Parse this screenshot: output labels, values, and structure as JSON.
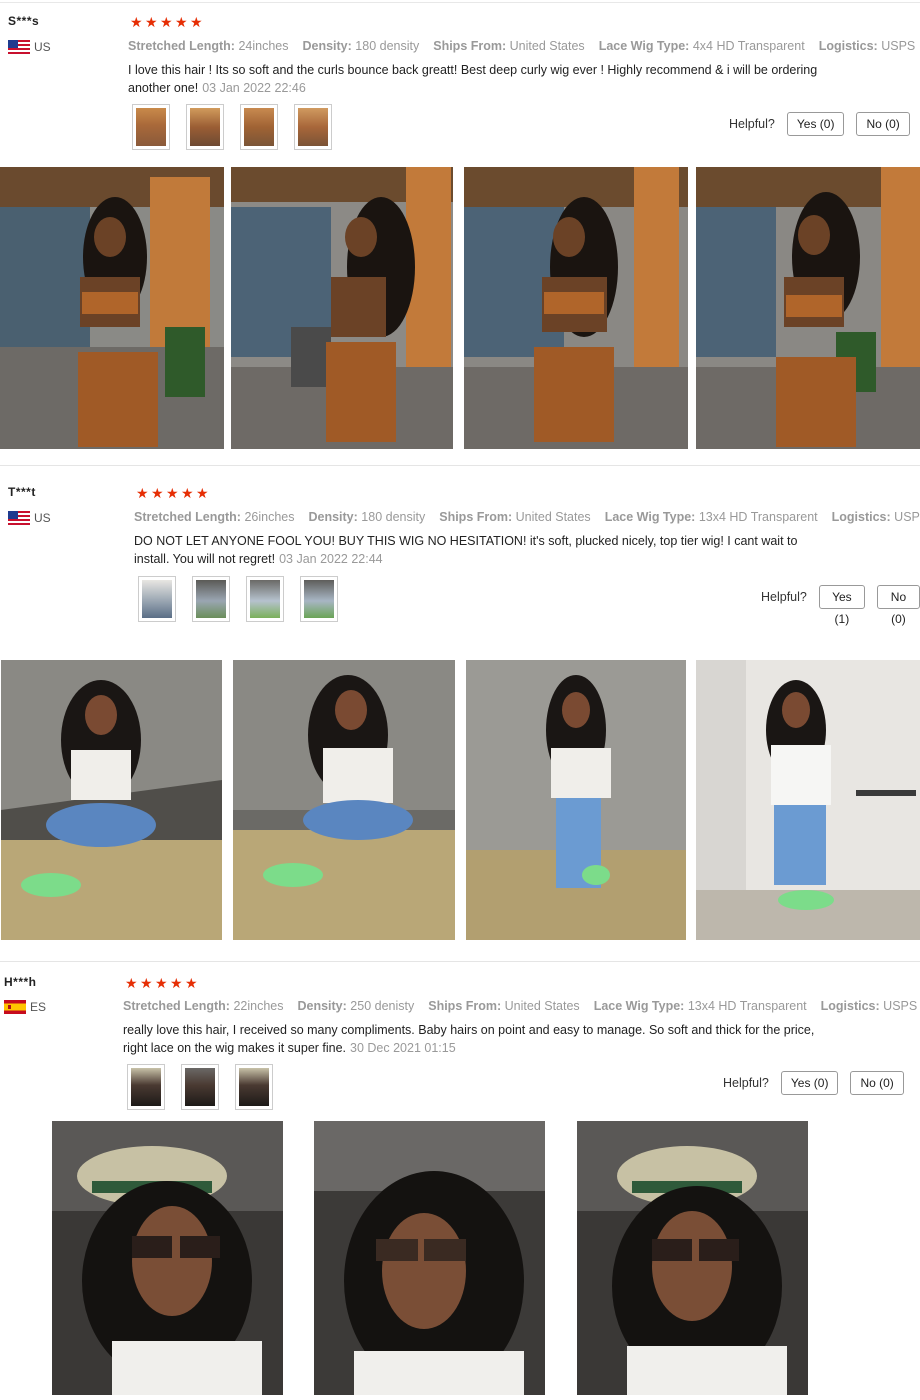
{
  "reviews": [
    {
      "user": "S***s",
      "country": "US",
      "flag_icon": "us-flag-icon",
      "rating": 5,
      "attributes": [
        {
          "key": "Stretched Length:",
          "value": "24inches"
        },
        {
          "key": "Density:",
          "value": "180 density"
        },
        {
          "key": "Ships From:",
          "value": "United States"
        },
        {
          "key": "Lace Wig Type:",
          "value": "4x4 HD Transparent"
        },
        {
          "key": "Logistics:",
          "value": "USPS"
        }
      ],
      "text": "I love this hair ! Its so soft and the curls bounce back greatt! Best deep curly wig ever ! Highly recommend & i will be ordering another one!",
      "date": "03 Jan 2022 22:46",
      "helpful_label": "Helpful?",
      "yes_label": "Yes (0)",
      "no_label": "No (0)"
    },
    {
      "user": "T***t",
      "country": "US",
      "flag_icon": "us-flag-icon",
      "rating": 5,
      "attributes": [
        {
          "key": "Stretched Length:",
          "value": "26inches"
        },
        {
          "key": "Density:",
          "value": "180 density"
        },
        {
          "key": "Ships From:",
          "value": "United States"
        },
        {
          "key": "Lace Wig Type:",
          "value": "13x4 HD Transparent"
        },
        {
          "key": "Logistics:",
          "value": "USPS"
        }
      ],
      "text": "DO NOT LET ANYONE FOOL YOU! BUY THIS WIG NO HESITATION! it's soft, plucked nicely, top tier wig! I cant wait to install. You will not regret!",
      "date": "03 Jan 2022 22:44",
      "helpful_label": "Helpful?",
      "yes_label": "Yes (1)",
      "no_label": "No (0)"
    },
    {
      "user": "H***h",
      "country": "ES",
      "flag_icon": "es-flag-icon",
      "rating": 5,
      "attributes": [
        {
          "key": "Stretched Length:",
          "value": "22inches"
        },
        {
          "key": "Density:",
          "value": "250 denisty"
        },
        {
          "key": "Ships From:",
          "value": "United States"
        },
        {
          "key": "Lace Wig Type:",
          "value": "13x4 HD Transparent"
        },
        {
          "key": "Logistics:",
          "value": "USPS"
        }
      ],
      "text": "really love this hair, I received so many compliments. Baby hairs on point and easy to manage. So soft and thick for the price, right lace on the wig makes it super fine.",
      "date": "30 Dec 2021 01:15",
      "helpful_label": "Helpful?",
      "yes_label": "Yes (0)",
      "no_label": "No (0)"
    }
  ],
  "colors": {
    "star": "#e62e04",
    "muted_text": "#999999"
  }
}
